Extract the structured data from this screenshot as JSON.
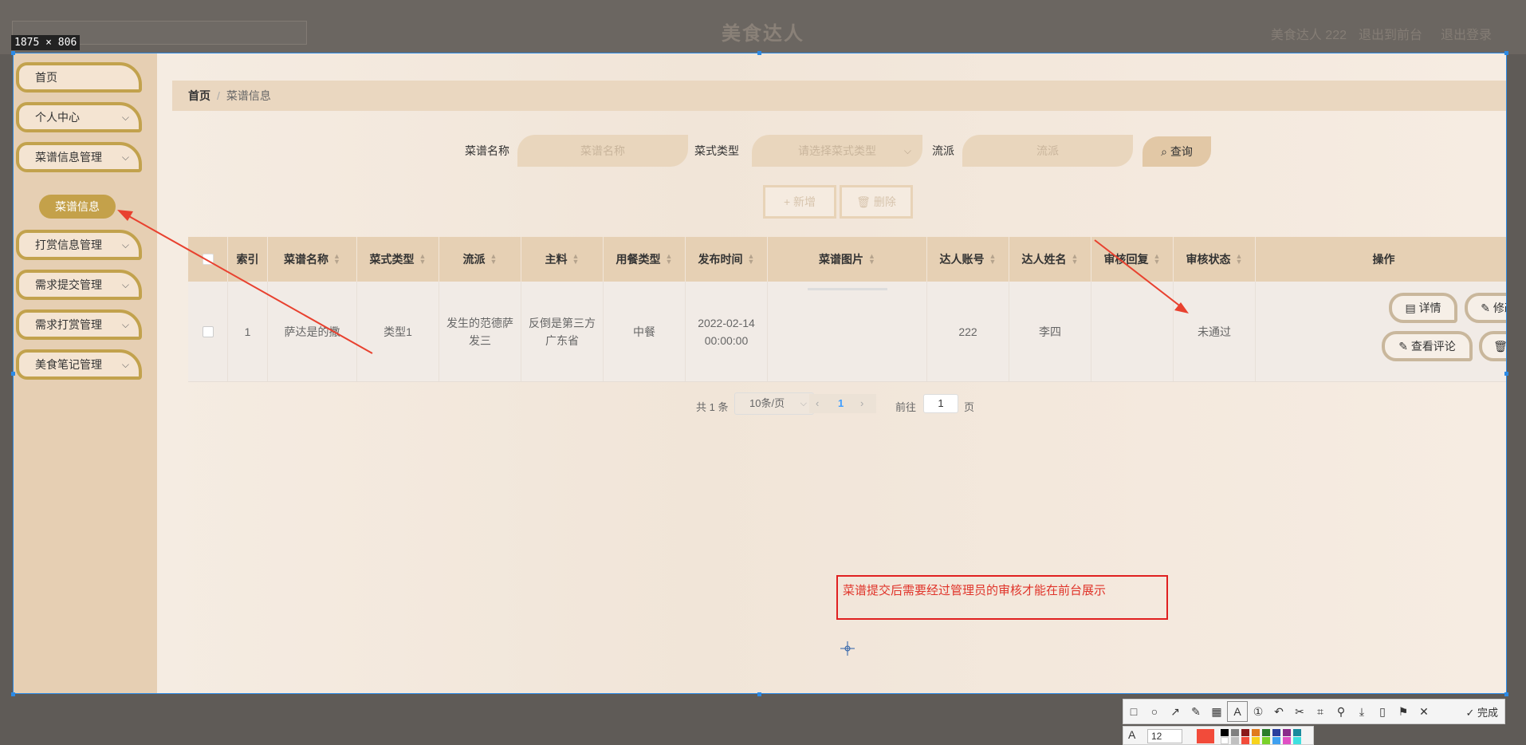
{
  "topbar": {
    "app_title": "美食达人",
    "user": "美食达人 222",
    "to_front": "退出到前台",
    "logout": "退出登录"
  },
  "capture_size": "1875 × 806",
  "sidebar": {
    "items": [
      {
        "label": "首页",
        "has_children": false
      },
      {
        "label": "个人中心",
        "has_children": true
      },
      {
        "label": "菜谱信息管理",
        "has_children": true
      },
      {
        "label": "打赏信息管理",
        "has_children": true
      },
      {
        "label": "需求提交管理",
        "has_children": true
      },
      {
        "label": "需求打赏管理",
        "has_children": true
      },
      {
        "label": "美食笔记管理",
        "has_children": true
      }
    ],
    "active_sub": "菜谱信息"
  },
  "breadcrumb": {
    "home": "首页",
    "current": "菜谱信息"
  },
  "search": {
    "name_label": "菜谱名称",
    "name_placeholder": "菜谱名称",
    "type_label": "菜式类型",
    "type_placeholder": "请选择菜式类型",
    "school_label": "流派",
    "school_placeholder": "流派",
    "query_label": "查询"
  },
  "actions": {
    "add_label": "+ 新增",
    "delete_label": "删除"
  },
  "table": {
    "columns": [
      "索引",
      "菜谱名称",
      "菜式类型",
      "流派",
      "主料",
      "用餐类型",
      "发布时间",
      "菜谱图片",
      "达人账号",
      "达人姓名",
      "审核回复",
      "审核状态",
      "操作"
    ],
    "rows": [
      {
        "index": "1",
        "name": "萨达是的撒",
        "type": "类型1",
        "school": "发生的范德萨发三",
        "main_ingredient": "反倒是第三方广东省",
        "meal_type": "中餐",
        "publish_time": "2022-02-14 00:00:00",
        "image": "",
        "account": "222",
        "person_name": "李四",
        "reply": "",
        "status": "未通过",
        "btn_detail": "详情",
        "btn_edit": "修改",
        "btn_comments": "查看评论",
        "btn_delete": "删除"
      }
    ]
  },
  "pagination": {
    "total": "共 1 条",
    "page_size": "10条/页",
    "current_page": "1",
    "goto_label": "前往",
    "goto_value": "1",
    "page_suffix": "页"
  },
  "annotation": "菜谱提交后需要经过管理员的审核才能在前台展示",
  "snip_toolbar": {
    "done_label": "完成",
    "font_size": "12",
    "accent_color": "#f24b3a"
  }
}
